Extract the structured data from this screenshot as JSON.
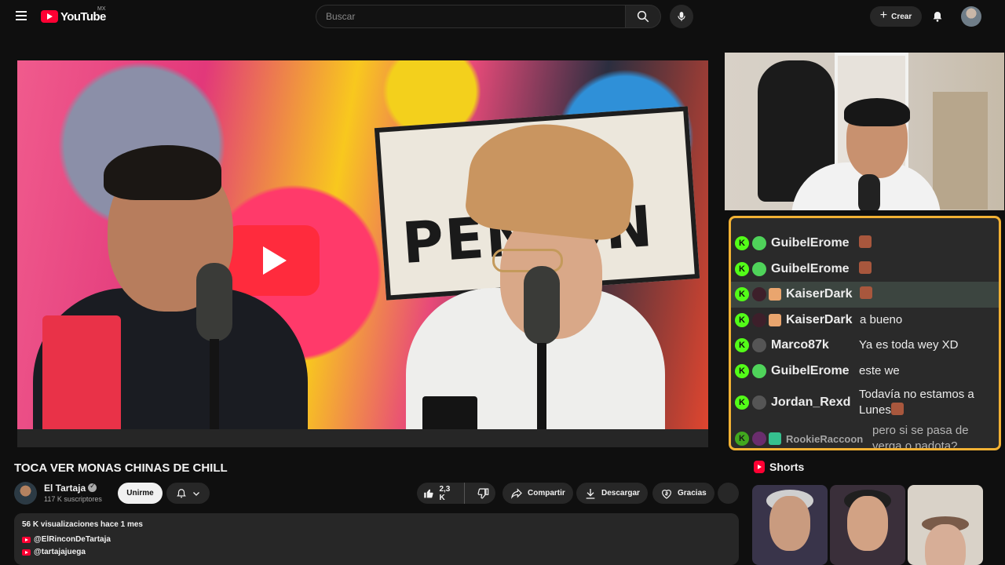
{
  "topbar": {
    "logo_text": "YouTube",
    "country_code": "MX",
    "search_placeholder": "Buscar",
    "create_label": "Crear"
  },
  "chat": {
    "messages": [
      {
        "user": "GuibelErome",
        "text": "",
        "emote": true,
        "avatar": "green"
      },
      {
        "user": "GuibelErome",
        "text": "",
        "emote": true,
        "avatar": "green"
      },
      {
        "user": "KaiserDark",
        "text": "",
        "emote": true,
        "avatar": "dark",
        "highlight": true
      },
      {
        "user": "KaiserDark",
        "text": "a bueno",
        "emote": false,
        "avatar": "dark"
      },
      {
        "user": "Marco87k",
        "text": "Ya es toda wey XD",
        "emote": false,
        "avatar": "gray"
      },
      {
        "user": "GuibelErome",
        "text": "este we",
        "emote": false,
        "avatar": "green"
      },
      {
        "user": "Jordan_Rexd",
        "text": "Todavía no estamos a Lunes",
        "emote": true,
        "avatar": "gray"
      },
      {
        "user": "RookieRaccoon",
        "text": "pero si se pasa de verga o nadota?",
        "emote": false,
        "avatar": "purple"
      }
    ]
  },
  "video": {
    "title": "TOCA VER MONAS CHINAS DE CHILL",
    "sign_text": "PEN  ON"
  },
  "channel": {
    "name": "El Tartaja",
    "subscribers": "117 K suscriptores",
    "join_label": "Unirme"
  },
  "actions": {
    "likes": "2,3 K",
    "share_label": "Compartir",
    "download_label": "Descargar",
    "thanks_label": "Gracias"
  },
  "description": {
    "meta": "56 K visualizaciones  hace 1 mes",
    "links": [
      "@ElRinconDeTartaja",
      "@tartajajuega"
    ]
  },
  "shorts": {
    "heading": "Shorts"
  },
  "colors": {
    "accent_red": "#ff0033",
    "chat_border": "#f2b134",
    "kick_green": "#53fc18"
  }
}
